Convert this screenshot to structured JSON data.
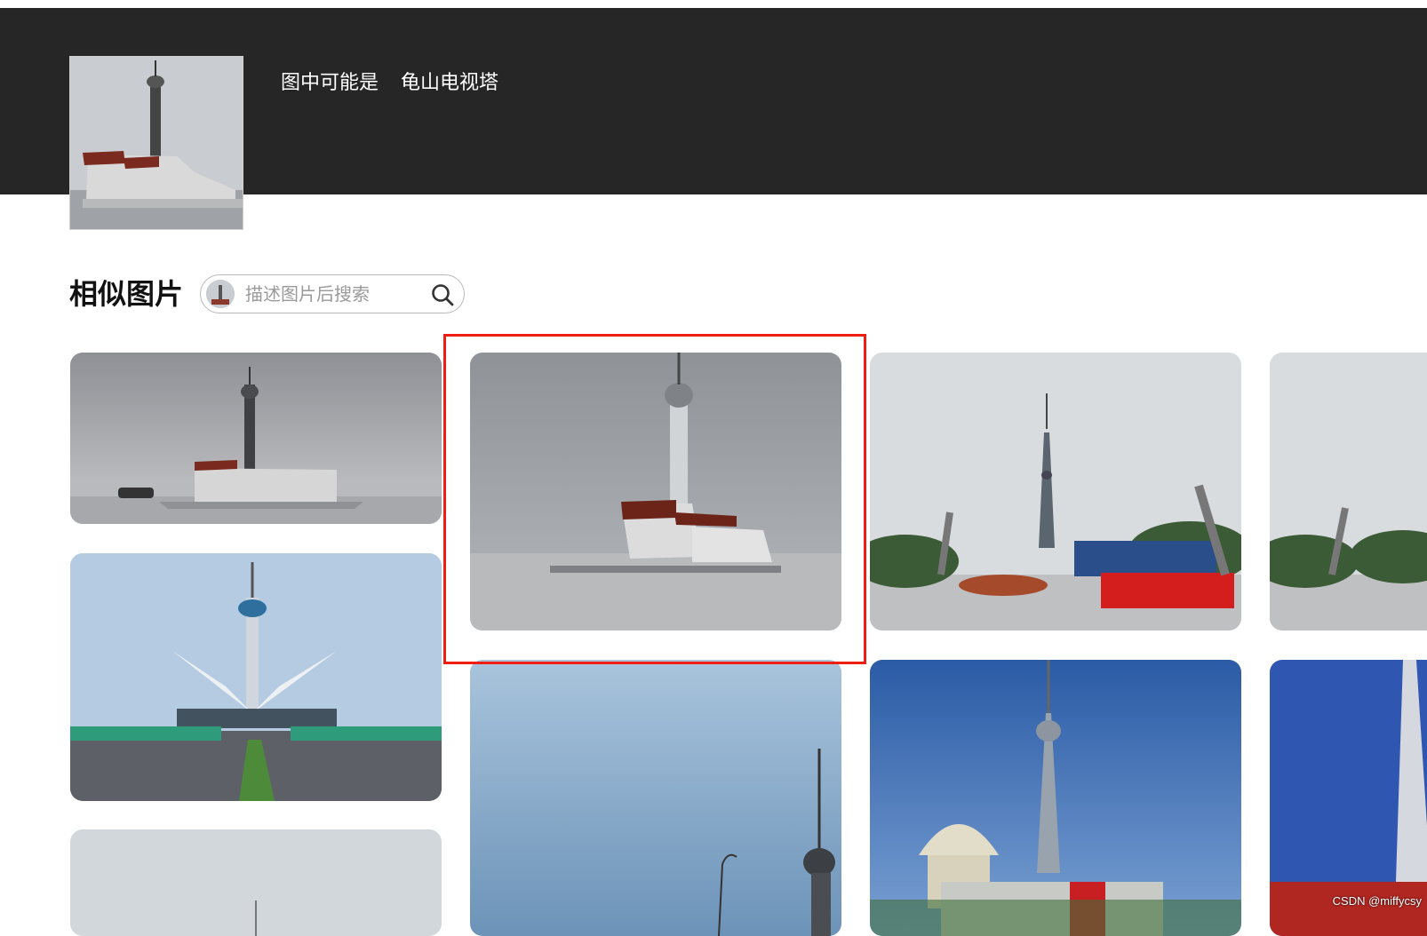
{
  "header": {
    "guess_prefix": "图中可能是",
    "guess_label": "龟山电视塔"
  },
  "similar": {
    "title": "相似图片",
    "search_placeholder": "描述图片后搜索"
  },
  "watermark": "CSDN @miffycsy",
  "colors": {
    "header_bg": "#262626",
    "highlight_border": "#f01d12"
  },
  "icons": {
    "search": "search-icon"
  }
}
